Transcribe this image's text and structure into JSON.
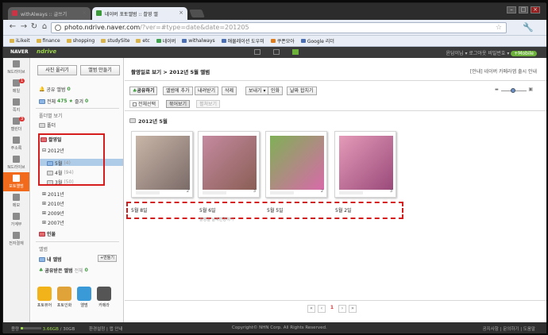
{
  "browser": {
    "tabs": [
      {
        "label": "withAlways :: 글쓰기"
      },
      {
        "label": "네이버 포토앨범 :: 촬영 앨"
      }
    ],
    "url_main": "photo.ndrive.naver.com",
    "url_query": "/?ver=#type=date&date=201205",
    "bookmarks": [
      "iLikeit",
      "finance",
      "shopping",
      "studySite",
      "etc",
      "네이버",
      "withalways",
      "애뮬레이션 도우미",
      "쿠폰모아",
      "Google 리더"
    ]
  },
  "naverbar": {
    "logo": "NAVER",
    "service": "ndrive",
    "right_text": "윤담이님 ▾  로그아웃  비밀번호 ▾",
    "mobile_badge": "+Mobile"
  },
  "leftnav": {
    "items": [
      {
        "label": "N드라이브"
      },
      {
        "label": "메일",
        "badge": "1"
      },
      {
        "label": "쪽지"
      },
      {
        "label": "캘린더",
        "badge": "3"
      },
      {
        "label": "주소록"
      },
      {
        "label": "N드라이브"
      },
      {
        "label": "포토앨범"
      },
      {
        "label": "메모"
      },
      {
        "label": "가계부"
      },
      {
        "label": "전자결재"
      }
    ]
  },
  "sidebar": {
    "upload_button": "사진 올리기",
    "make_album_button": "앨범 만들기",
    "shared_label": "공유 앨범",
    "shared_count": "0",
    "all_label": "전체",
    "all_count": "475",
    "fav_label": "즐겨",
    "fav_count": "0",
    "section_folder": "폴더별 보기",
    "folder_label": "폴더",
    "shooting_date": "촬영일",
    "year_2012": "2012년",
    "months": [
      {
        "label": "5월",
        "count": "(4)"
      },
      {
        "label": "4월",
        "count": "(94)"
      },
      {
        "label": "3월",
        "count": "(50)"
      }
    ],
    "years": [
      "2011년",
      "2010년",
      "2009년",
      "2007년"
    ],
    "people": "인물",
    "section_album": "앨범",
    "my_album": "내 앨범",
    "add_button": "+만들기",
    "received_album": "공유받은 앨범",
    "received_label": "전체",
    "received_count": "0",
    "apps": [
      {
        "label": "포토뷰어",
        "color": "#f2b21a"
      },
      {
        "label": "포토인화",
        "color": "#e0a33a"
      },
      {
        "label": "앨범",
        "color": "#3a9ad8"
      },
      {
        "label": "카메라",
        "color": "#555555"
      }
    ]
  },
  "main": {
    "breadcrumb": "촬영일로 보기 > 2012년 5월 앨범",
    "notice": "[안내] 네이버 카메라앱 출시 안내",
    "toolbar": [
      "공유하기",
      "앨범에 추가",
      "내려받기",
      "삭제",
      "보내기 ▾",
      "인화",
      "날짜 합치기"
    ],
    "view_tabs": [
      "전체선택",
      "묶어보기",
      "펼쳐보기"
    ],
    "date_header": "2012년 5월",
    "photos": [
      {
        "label": "5월 8일",
        "count": "2",
        "colors": [
          "#c9b6a8",
          "#7b6b68"
        ]
      },
      {
        "label": "5월 6일",
        "count": "3",
        "colors": [
          "#c58aa0",
          "#8a5e55"
        ]
      },
      {
        "label": "5월 5일",
        "count": "2",
        "colors": [
          "#7fb056",
          "#d86aa9"
        ]
      },
      {
        "label": "5월 2일",
        "count": "3",
        "colors": [
          "#e49ab8",
          "#9a4a7a"
        ]
      }
    ],
    "hint": "촬영일 날짜변경하기",
    "pager": {
      "prev_first": "«",
      "prev": "‹",
      "current": "1",
      "next": "›",
      "next_last": "»"
    }
  },
  "status": {
    "quota_label": "용량",
    "used": "3.66GB",
    "total": "30GB",
    "used_fraction": 0.12,
    "links_left": "환경설정  |  앱 안내",
    "copyright": "Copyright© NHN Corp. All Rights Reserved.",
    "links_right": "공지사항  |  문의하기  |  도움말"
  }
}
